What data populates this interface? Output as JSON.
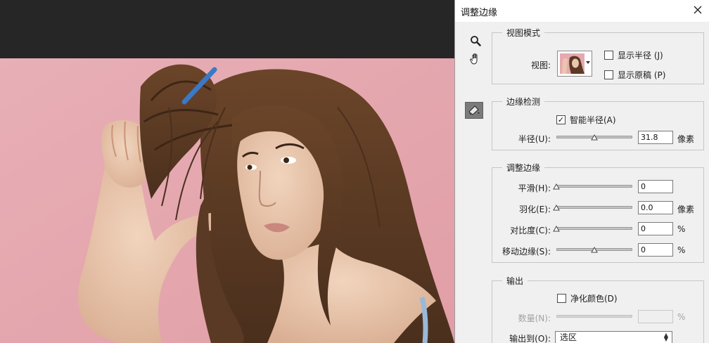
{
  "dialog": {
    "title": "调整边缘",
    "view_mode": {
      "group_title": "视图模式",
      "view_label": "视图:",
      "show_radius_label": "显示半径 (J)",
      "show_radius_checked": false,
      "show_original_label": "显示原稿 (P)",
      "show_original_checked": false
    },
    "edge_detection": {
      "group_title": "边缘检测",
      "smart_radius_label": "智能半径(A)",
      "smart_radius_checked": true,
      "radius_label": "半径(U):",
      "radius_value": "31.8",
      "radius_unit": "像素",
      "radius_slider_fraction": 0.5
    },
    "adjust_edge": {
      "group_title": "调整边缘",
      "smooth_label": "平滑(H):",
      "smooth_value": "0",
      "smooth_slider_fraction": 0,
      "feather_label": "羽化(E):",
      "feather_value": "0.0",
      "feather_unit": "像素",
      "feather_slider_fraction": 0,
      "contrast_label": "对比度(C):",
      "contrast_value": "0",
      "contrast_unit": "%",
      "contrast_slider_fraction": 0,
      "shift_edge_label": "移动边缘(S):",
      "shift_edge_value": "0",
      "shift_edge_unit": "%",
      "shift_edge_slider_fraction": 0.5
    },
    "output": {
      "group_title": "输出",
      "decontaminate_label": "净化颜色(D)",
      "decontaminate_checked": false,
      "amount_label": "数量(N):",
      "amount_value": "",
      "amount_unit": "%",
      "output_to_label": "输出到(O):",
      "output_to_value": "选区"
    }
  },
  "icons": {
    "close": "close-icon",
    "zoom": "zoom-icon",
    "hand": "hand-icon",
    "refine_brush": "refine-radius-brush-icon"
  },
  "colors": {
    "photo_background": "#e6a9b0",
    "hair": "#5a3a24",
    "skin": "#e9c7ae",
    "comb": "#3a78c8"
  }
}
